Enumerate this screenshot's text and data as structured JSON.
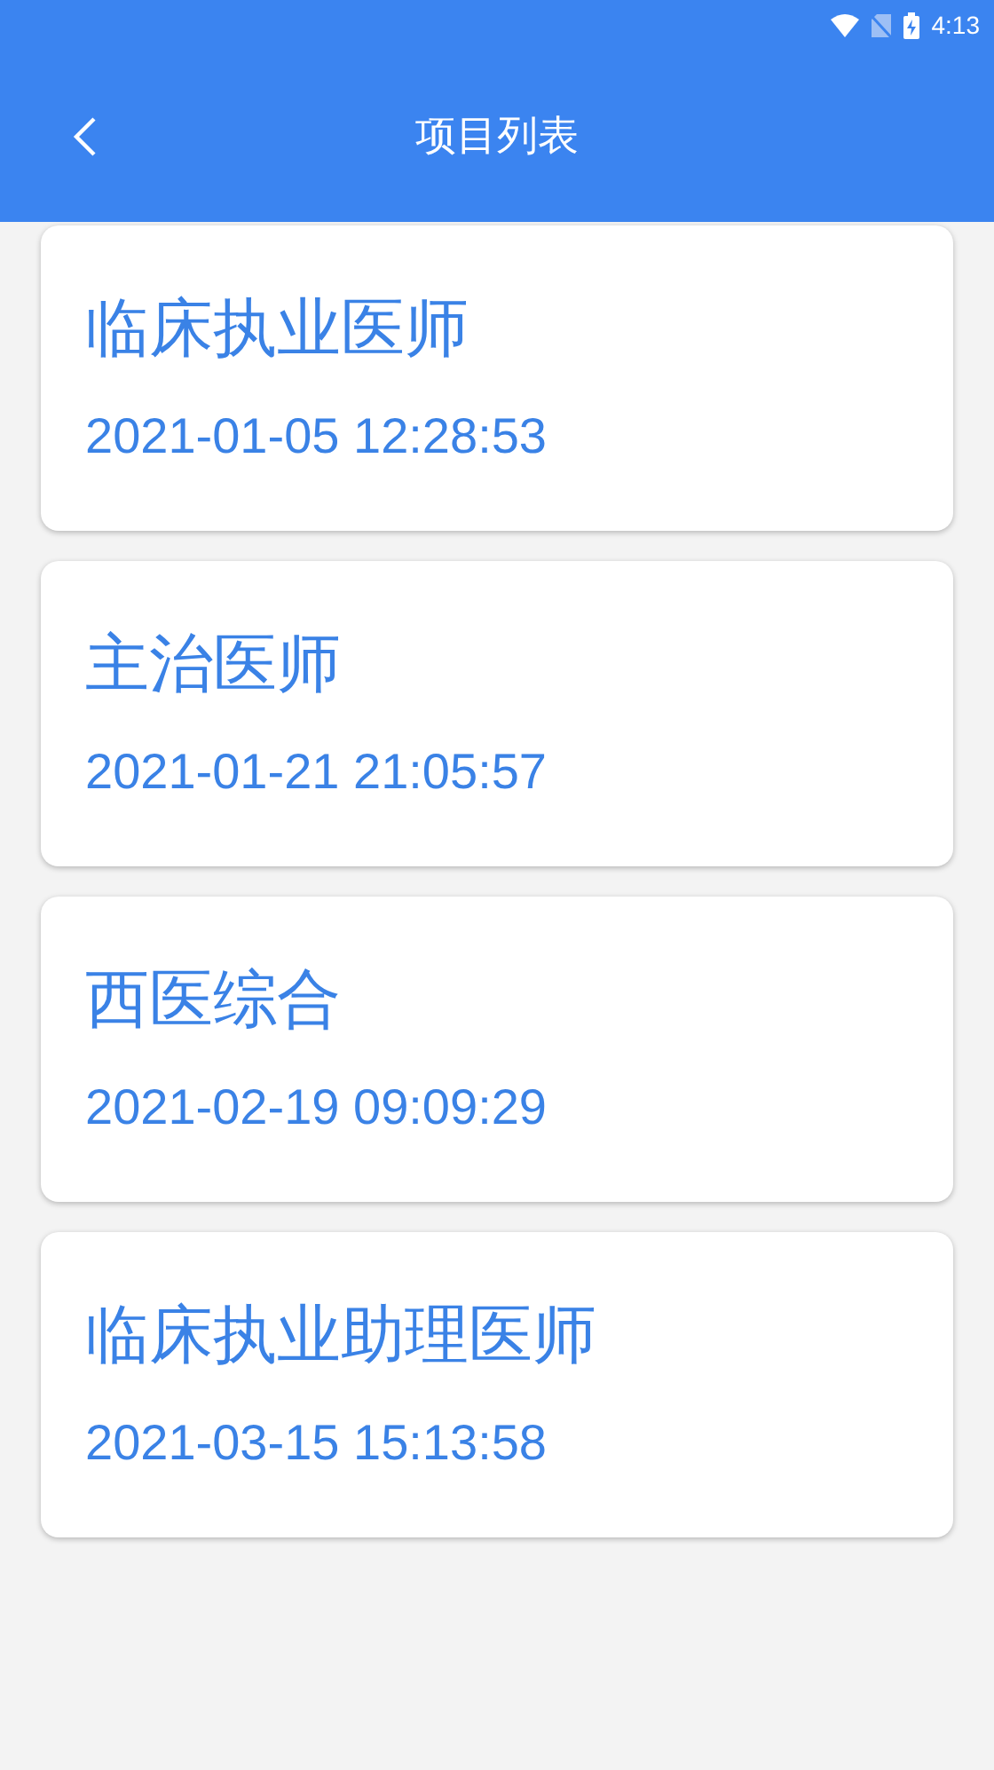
{
  "status_bar": {
    "time": "4:13"
  },
  "header": {
    "title": "项目列表"
  },
  "items": [
    {
      "name": "临床执业医师",
      "time": "2021-01-05 12:28:53"
    },
    {
      "name": "主治医师",
      "time": "2021-01-21 21:05:57"
    },
    {
      "name": "西医综合",
      "time": "2021-02-19 09:09:29"
    },
    {
      "name": "临床执业助理医师",
      "time": "2021-03-15 15:13:58"
    }
  ]
}
